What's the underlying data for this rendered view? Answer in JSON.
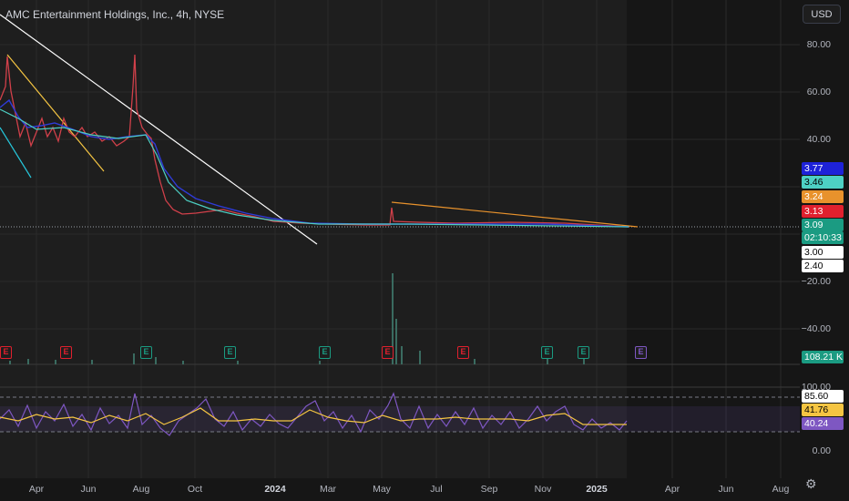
{
  "header": {
    "title": "AMC Entertainment Holdings, Inc., 4h, NYSE",
    "currency": "USD"
  },
  "price_axis": {
    "labels": [
      "80.00",
      "60.00",
      "40.00",
      "−20.00",
      "−40.00"
    ]
  },
  "indicator_badges": [
    {
      "text": "3.77",
      "bg": "#1e22d8",
      "fg": "#ffffff"
    },
    {
      "text": "3.46",
      "bg": "#4dd0c4",
      "fg": "#000000"
    },
    {
      "text": "3.24",
      "bg": "#e8922c",
      "fg": "#ffffff"
    },
    {
      "text": "3.13",
      "bg": "#e0202e",
      "fg": "#ffffff"
    },
    {
      "text": "3.09",
      "bg": "#1b9b82",
      "fg": "#ffffff"
    },
    {
      "text": "02:10:33",
      "bg": "#1b9b82",
      "fg": "#ffffff"
    },
    {
      "text": "3.00",
      "bg": "#ffffff",
      "fg": "#000000"
    },
    {
      "text": "2.40",
      "bg": "#ffffff",
      "fg": "#000000"
    }
  ],
  "volume": {
    "label": "108.21 K",
    "bg": "#1b9b82"
  },
  "rsi": {
    "axis_labels": [
      "100.00",
      "0.00"
    ],
    "badges": [
      {
        "text": "85.60",
        "bg": "#ffffff",
        "fg": "#000000"
      },
      {
        "text": "41.76",
        "bg": "#f5c542",
        "fg": "#000000"
      },
      {
        "text": "40.24",
        "bg": "#7e57c2",
        "fg": "#ffffff"
      }
    ]
  },
  "time_axis": {
    "labels": [
      "Apr",
      "Jun",
      "Aug",
      "Oct",
      "2024",
      "Mar",
      "May",
      "Jul",
      "Sep",
      "Nov",
      "2025",
      "Apr",
      "Jun",
      "Aug"
    ]
  },
  "earnings_markers": [
    {
      "letter": "E",
      "color": "#e0202e"
    },
    {
      "letter": "E",
      "color": "#e0202e"
    },
    {
      "letter": "E",
      "color": "#1b9b82"
    },
    {
      "letter": "E",
      "color": "#1b9b82"
    },
    {
      "letter": "E",
      "color": "#1b9b82"
    },
    {
      "letter": "E",
      "color": "#e0202e"
    },
    {
      "letter": "E",
      "color": "#e0202e"
    },
    {
      "letter": "E",
      "color": "#1b9b82"
    },
    {
      "letter": "E",
      "color": "#1b9b82"
    },
    {
      "letter": "E",
      "color": "#7e57c2"
    }
  ],
  "icons": {
    "settings": "gear-icon"
  }
}
